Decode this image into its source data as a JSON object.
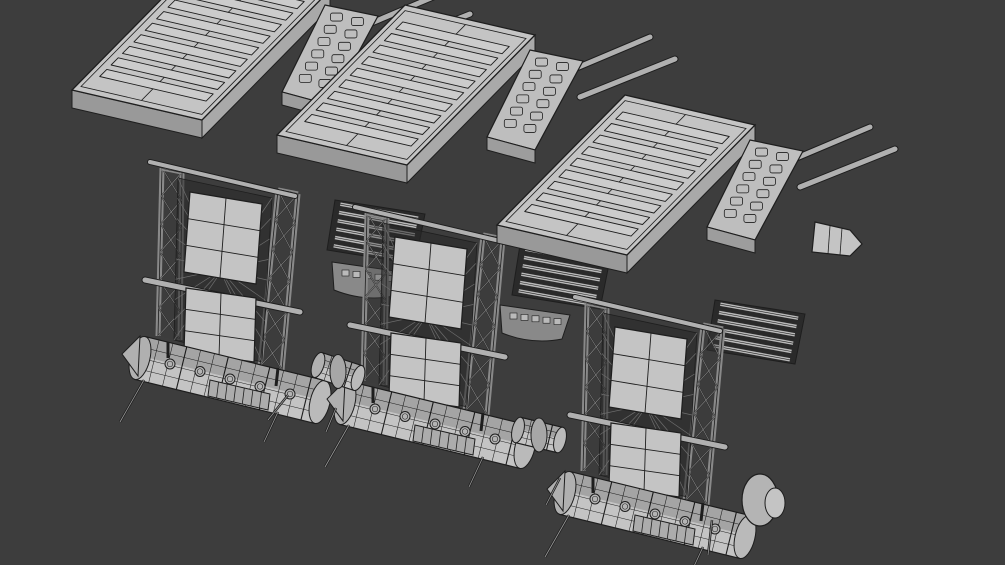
{
  "viewport": {
    "background_color": "#3d3d3d",
    "shading": "solid",
    "mesh_color": "#c4c4c4",
    "wire_color": "#1e1e1e"
  },
  "model": {
    "subject": "modular-station-segments",
    "module_count": 3,
    "icons": [
      "solar-panel-icon",
      "truss-frame-icon",
      "cylinder-hull-icon",
      "antenna-icon",
      "connector-icon"
    ]
  }
}
